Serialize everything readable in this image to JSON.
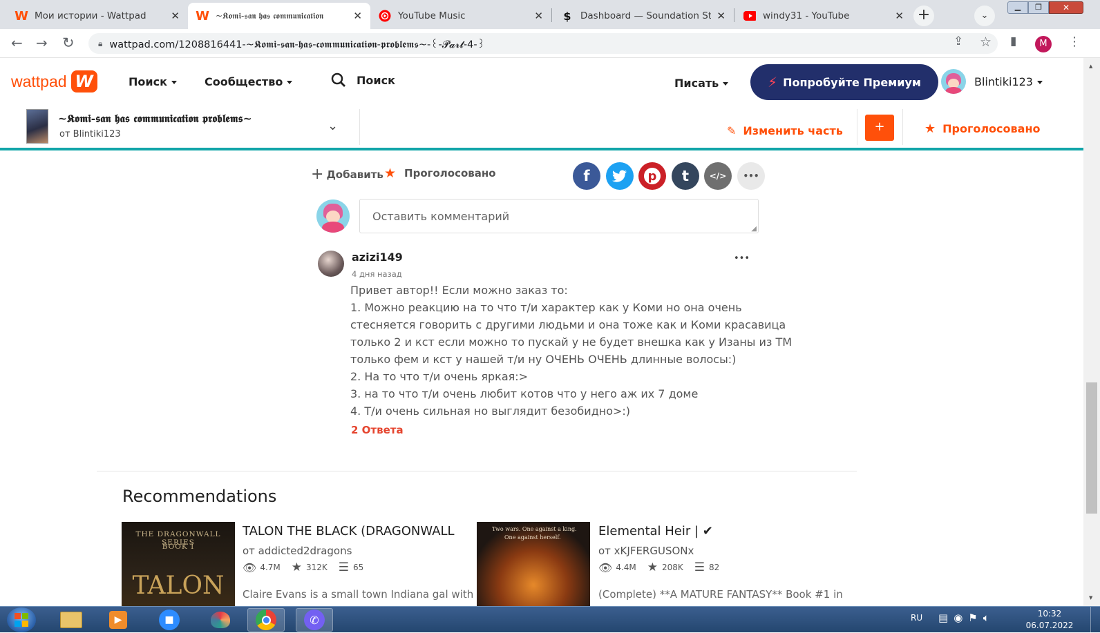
{
  "browser": {
    "tabs": [
      {
        "title": "Мои истории - Wattpad",
        "icon": "wattpad-icon",
        "active": false
      },
      {
        "title": "~𝕶𝖔𝖒𝖎-𝖘𝖆𝖓 𝖍𝖆𝖘 𝖈𝖔𝖒𝖒𝖚𝖓𝖎𝖈𝖆𝖙𝖎𝖔𝖓",
        "icon": "wattpad-icon",
        "active": true
      },
      {
        "title": "YouTube Music",
        "icon": "youtube-music-icon",
        "active": false
      },
      {
        "title": "Dashboard — Soundation Stu",
        "icon": "soundation-icon",
        "active": false
      },
      {
        "title": "windy31 - YouTube",
        "icon": "youtube-icon",
        "active": false
      }
    ],
    "address": "wattpad.com/1208816441-~𝕶𝖔𝖒𝖎-𝖘𝖆𝖓-𝖍𝖆𝖘-𝖈𝖔𝖒𝖒𝖚𝖓𝖎𝖈𝖆𝖙𝖎𝖔𝖓-𝖕𝖗𝖔𝖇𝖑𝖊𝖒𝖘~-꒰-𝓟𝓪𝓻𝓽-4-꒱",
    "profile_letter": "M"
  },
  "header": {
    "logo": "wattpad",
    "search_menu": "Поиск",
    "community_menu": "Сообщество",
    "search_placeholder": "Поиск",
    "write_menu": "Писать",
    "premium_button": "Попробуйте Премиум",
    "username": "Blintiki123"
  },
  "story_bar": {
    "title": "~𝕶𝖔𝖒𝖎-𝖘𝖆𝖓 𝖍𝖆𝖘 𝖈𝖔𝖒𝖒𝖚𝖓𝖎𝖈𝖆𝖙𝖎𝖔𝖓 𝖕𝖗𝖔𝖇𝖑𝖊𝖒𝖘~",
    "author": "от Blintiki123",
    "edit_part": "Изменить часть",
    "plus_label": "+",
    "voted": "Проголосовано"
  },
  "actions": {
    "add": "Добавить",
    "voted": "Проголосовано",
    "social": [
      {
        "name": "facebook",
        "glyph": "f",
        "color": "#3b5998"
      },
      {
        "name": "twitter",
        "glyph": "t",
        "color": "#1da1f2"
      },
      {
        "name": "pinterest",
        "glyph": "p",
        "color": "#cb2027"
      },
      {
        "name": "tumblr",
        "glyph": "t",
        "color": "#34465d"
      },
      {
        "name": "embed",
        "glyph": "</>",
        "color": "#6f6f6f"
      },
      {
        "name": "more",
        "glyph": "•••",
        "color": "#e9e9e9"
      }
    ]
  },
  "comment_box": {
    "placeholder": "Оставить комментарий"
  },
  "comment": {
    "username": "azizi149",
    "time": "4 дня назад",
    "lines": [
      "Привет автор!! Если можно заказ то:",
      "1. Можно реакцию на то что т/и характер как у Коми но она очень",
      "стесняется говорить с другими людьми и она тоже как и Коми красавица",
      "только 2 и кст если можно то пускай у не будет внешка как у Изаны из ТМ",
      "только фем и кст у нашей т/и ну ОЧЕНЬ ОЧЕНЬ длинные волосы:)",
      "2. На то что т/и очень яркая:>",
      "3. на то что т/и очень любит котов что у него аж их 7 доме",
      "4. Т/и очень сильная но выглядит безобидно>:)"
    ],
    "replies": "2 Ответа",
    "more": "•••"
  },
  "recommendations": {
    "heading": "Recommendations",
    "items": [
      {
        "title": "TALON THE BLACK (DRAGONWALL",
        "author": "от addicted2dragons",
        "views": "4.7M",
        "votes": "312K",
        "parts": "65",
        "blurb": "Claire Evans is a small town Indiana gal with a",
        "cover_text_1": "THE DRAGONWALL SERIES",
        "cover_text_2": "BOOK I",
        "cover_title": "TALON"
      },
      {
        "title": "Elemental Heir | ✔",
        "author": "от xKJFERGUSONx",
        "views": "4.4M",
        "votes": "208K",
        "parts": "82",
        "blurb": "(Complete) **A MATURE FANTASY** Book #1 in",
        "cover_text_1": "Two wars. One against a king.",
        "cover_text_2": "One against herself."
      }
    ]
  },
  "taskbar": {
    "lang": "RU",
    "time": "10:32",
    "date": "06.07.2022"
  }
}
